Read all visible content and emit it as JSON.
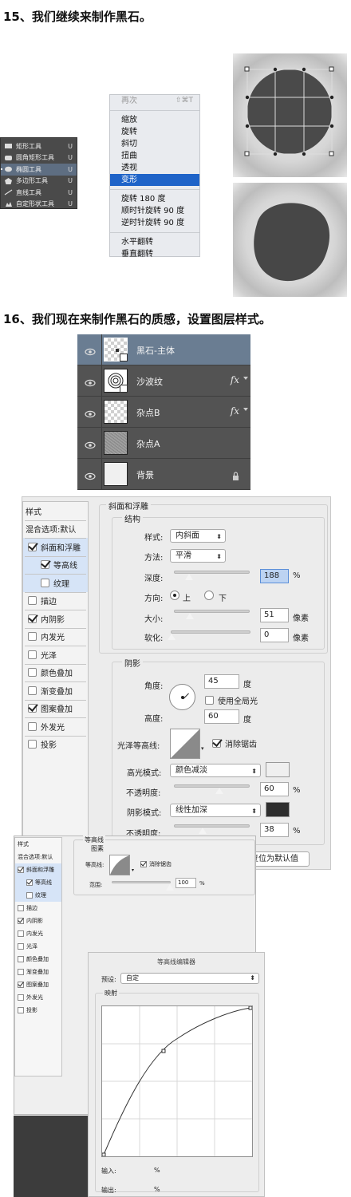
{
  "step15": {
    "title": "15、我们继续来制作黑石。"
  },
  "tools": {
    "items": [
      {
        "label": "矩形工具",
        "key": "U",
        "icon": "rectangle-icon",
        "selected": false
      },
      {
        "label": "圆角矩形工具",
        "key": "U",
        "icon": "rounded-rectangle-icon",
        "selected": false
      },
      {
        "label": "椭圆工具",
        "key": "U",
        "icon": "ellipse-icon",
        "selected": true
      },
      {
        "label": "多边形工具",
        "key": "U",
        "icon": "polygon-icon",
        "selected": false
      },
      {
        "label": "直线工具",
        "key": "U",
        "icon": "line-icon",
        "selected": false
      },
      {
        "label": "自定形状工具",
        "key": "U",
        "icon": "custom-shape-icon",
        "selected": false
      }
    ]
  },
  "context_menu": {
    "again": {
      "label": "再次",
      "shortcut": "⇧⌘T"
    },
    "group1": [
      "缩放",
      "旋转",
      "斜切",
      "扭曲",
      "透视",
      "变形"
    ],
    "highlighted": "变形",
    "group2": [
      "旋转 180 度",
      "顺时针旋转 90 度",
      "逆时针旋转 90 度"
    ],
    "group3": [
      "水平翻转",
      "垂直翻转"
    ]
  },
  "step16": {
    "title": "16、我们现在来制作黑石的质感，设置图层样式。"
  },
  "layers": [
    {
      "name": "黑石-主体",
      "selected": true,
      "fx": "",
      "thumb": "checker-shape"
    },
    {
      "name": "沙波纹",
      "selected": false,
      "fx": "fx",
      "thumb": "ripple"
    },
    {
      "name": "杂点B",
      "selected": false,
      "fx": "fx",
      "thumb": "checker"
    },
    {
      "name": "杂点A",
      "selected": false,
      "fx": "",
      "thumb": "noise"
    },
    {
      "name": "背景",
      "selected": false,
      "fx": "",
      "thumb": "white",
      "locked": true
    }
  ],
  "layer_style": {
    "styles_header": "样式",
    "blend_default": "混合选项:默认",
    "effects": [
      {
        "label": "斜面和浮雕",
        "checked": true,
        "sub": false,
        "highlighted": true
      },
      {
        "label": "等高线",
        "checked": true,
        "sub": true,
        "highlighted": true
      },
      {
        "label": "纹理",
        "checked": false,
        "sub": true,
        "highlighted": true
      },
      {
        "label": "描边",
        "checked": false,
        "sub": false,
        "highlighted": false
      },
      {
        "label": "内阴影",
        "checked": true,
        "sub": false,
        "highlighted": false
      },
      {
        "label": "内发光",
        "checked": false,
        "sub": false,
        "highlighted": false
      },
      {
        "label": "光泽",
        "checked": false,
        "sub": false,
        "highlighted": false
      },
      {
        "label": "颜色叠加",
        "checked": false,
        "sub": false,
        "highlighted": false
      },
      {
        "label": "渐变叠加",
        "checked": false,
        "sub": false,
        "highlighted": false
      },
      {
        "label": "图案叠加",
        "checked": true,
        "sub": false,
        "highlighted": false
      },
      {
        "label": "外发光",
        "checked": false,
        "sub": false,
        "highlighted": false
      },
      {
        "label": "投影",
        "checked": false,
        "sub": false,
        "highlighted": false
      }
    ],
    "bevel": {
      "section_title": "斜面和浮雕",
      "structure_title": "结构",
      "style_label": "样式:",
      "style_value": "内斜面",
      "technique_label": "方法:",
      "technique_value": "平滑",
      "depth_label": "深度:",
      "depth_value": "188",
      "depth_unit": "%",
      "depth_level": 0.19,
      "direction_label": "方向:",
      "dir_up": "上",
      "dir_down": "下",
      "size_label": "大小:",
      "size_value": "51",
      "size_unit": "像素",
      "size_level": 0.2,
      "soften_label": "软化:",
      "soften_value": "0",
      "soften_unit": "像素",
      "soften_level": 0.0
    },
    "shading": {
      "title": "阴影",
      "angle_label": "角度:",
      "angle_value": "45",
      "angle_unit": "度",
      "global_light": "使用全局光",
      "altitude_label": "高度:",
      "altitude_value": "60",
      "altitude_unit": "度",
      "gloss_label": "光泽等高线:",
      "anti_alias": "消除锯齿",
      "highlight_mode_label": "高光模式:",
      "highlight_mode": "颜色减淡",
      "highlight_color": "#efefef",
      "highlight_opacity_label": "不透明度:",
      "highlight_opacity": "60",
      "highlight_opacity_level": 0.6,
      "shadow_mode_label": "阴影模式:",
      "shadow_mode": "线性加深",
      "shadow_color": "#2e2e2e",
      "shadow_opacity_label": "不透明度:",
      "shadow_opacity": "38",
      "shadow_opacity_level": 0.38,
      "percent": "%"
    },
    "reset_button": "复位为默认值"
  },
  "mini_style": {
    "styles_header": "样式",
    "blend_default": "混合选项:默认",
    "contour_section": "等高线",
    "elements_title": "图素",
    "contour_label": "等高线:",
    "anti_alias": "消除锯齿",
    "range_label": "范围:",
    "range_value": "100",
    "range_unit": "%",
    "range_level": 1.0
  },
  "contour_editor": {
    "title": "等高线编辑器",
    "preset_label": "预设:",
    "preset_value": "自定",
    "mapping_title": "映射",
    "input_label": "输入:",
    "output_label": "输出:",
    "percent": "%"
  }
}
